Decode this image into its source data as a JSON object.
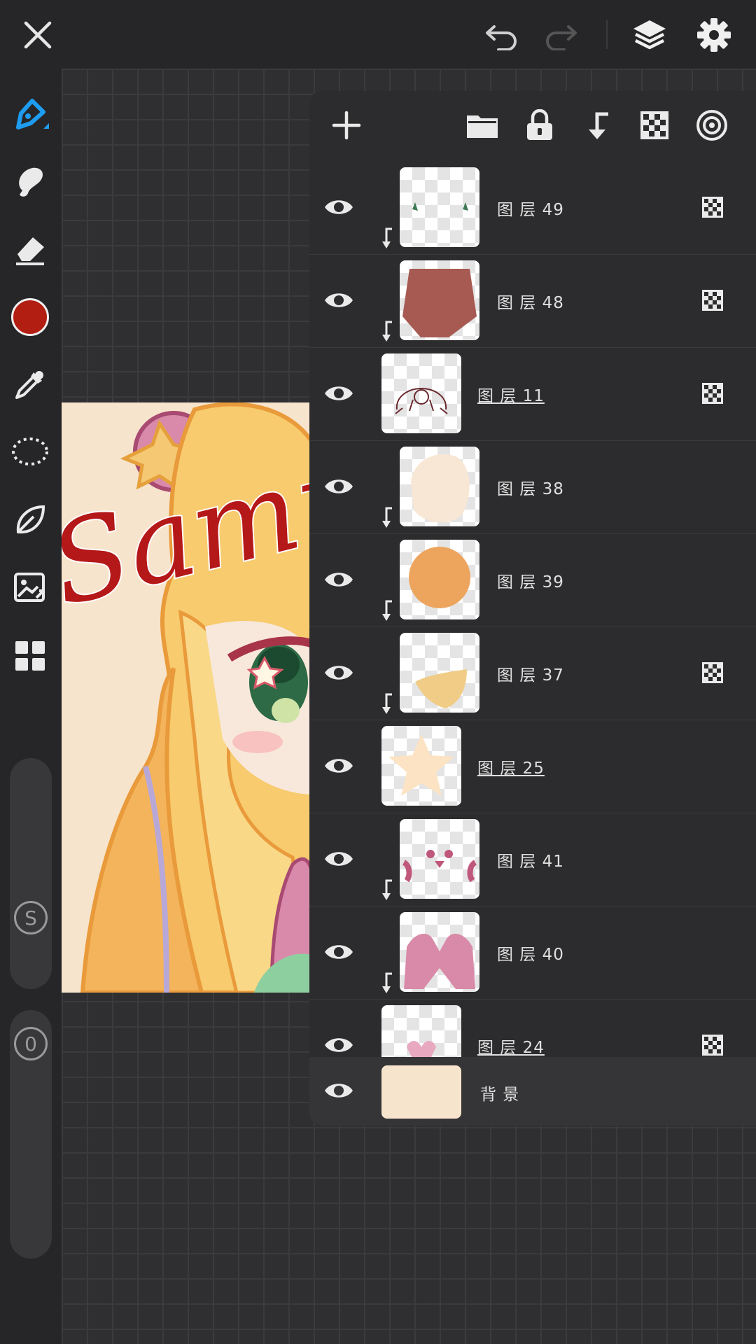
{
  "top_bar": {
    "close_icon": "close-icon",
    "undo_icon": "undo-icon",
    "redo_icon": "redo-icon",
    "layers_icon": "layers-icon",
    "settings_icon": "gear-icon"
  },
  "tools": [
    "brush-pen-icon",
    "smudge-icon",
    "eraser-icon",
    "color-swatch",
    "eyedropper-icon",
    "lasso-icon",
    "leaf-icon",
    "image-import-icon",
    "grid-apps-icon"
  ],
  "brush_color": "#b21e12",
  "size_slider": {
    "label": "S"
  },
  "opacity_slider": {
    "label": "0"
  },
  "artwork": {
    "watermark": "Sample."
  },
  "layers_panel": {
    "toolbar_icons": [
      "plus-icon",
      "folder-icon",
      "lock-icon",
      "clip-icon",
      "alpha-lock-icon",
      "blend-target-icon"
    ],
    "layers": [
      {
        "name": "图 层 49",
        "clipped": true,
        "alpha_lock": true,
        "selected": false,
        "thumb": "green-marks"
      },
      {
        "name": "图 层 48",
        "clipped": true,
        "alpha_lock": true,
        "selected": false,
        "thumb": "brown-shape"
      },
      {
        "name": "图 层 11",
        "clipped": false,
        "alpha_lock": true,
        "selected": true,
        "thumb": "line-sketch"
      },
      {
        "name": "图 层 38",
        "clipped": true,
        "alpha_lock": false,
        "selected": false,
        "thumb": "cream-blob"
      },
      {
        "name": "图 层 39",
        "clipped": true,
        "alpha_lock": false,
        "selected": false,
        "thumb": "orange-blob"
      },
      {
        "name": "图 层 37",
        "clipped": true,
        "alpha_lock": true,
        "selected": false,
        "thumb": "yellow-piece"
      },
      {
        "name": "图 层 25",
        "clipped": false,
        "alpha_lock": false,
        "selected": true,
        "thumb": "star"
      },
      {
        "name": "图 层 41",
        "clipped": true,
        "alpha_lock": false,
        "selected": false,
        "thumb": "pink-dots"
      },
      {
        "name": "图 层 40",
        "clipped": true,
        "alpha_lock": false,
        "selected": false,
        "thumb": "pink-bow"
      },
      {
        "name": "图 层 24",
        "clipped": false,
        "alpha_lock": true,
        "selected": true,
        "thumb": "pink-small"
      }
    ],
    "background_layer": {
      "name": "背 景",
      "color": "#f7e4cc"
    }
  }
}
